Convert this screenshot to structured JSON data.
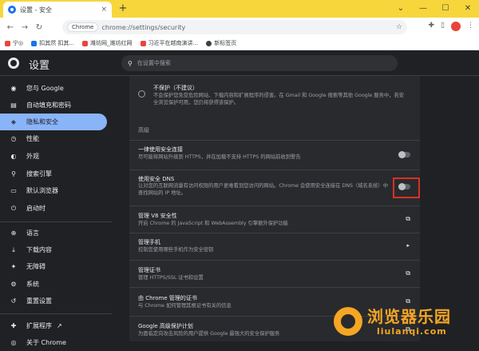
{
  "browser": {
    "tab_title": "设置 - 安全",
    "tab_close": "×",
    "new_tab": "+",
    "omnibox_chip": "Chrome",
    "url": "chrome://settings/security",
    "window_controls": [
      "⌄",
      "—",
      "☐",
      "✕"
    ]
  },
  "bookmarks": [
    {
      "label": "宁◎",
      "color": "#e8453c"
    },
    {
      "label": "扣其然 扣其...",
      "color": "#1a73e8"
    },
    {
      "label": "潍坊网_潍坊红网",
      "color": "#e8453c"
    },
    {
      "label": "习近平在越南演讲...",
      "color": "#e8453c"
    },
    {
      "label": "新标签页",
      "color": "#3c4043"
    }
  ],
  "settings": {
    "title": "设置",
    "search_placeholder": "在设置中搜索"
  },
  "sidebar": {
    "items": [
      {
        "label": "您与 Google",
        "icon": "person-icon",
        "glyph": "◉"
      },
      {
        "label": "自动填充和密码",
        "icon": "clipboard-icon",
        "glyph": "▤"
      },
      {
        "label": "隐私和安全",
        "icon": "shield-icon",
        "glyph": "◈"
      },
      {
        "label": "性能",
        "icon": "speedometer-icon",
        "glyph": "◷"
      },
      {
        "label": "外观",
        "icon": "palette-icon",
        "glyph": "◐"
      },
      {
        "label": "搜索引擎",
        "icon": "search-icon",
        "glyph": "⚲"
      },
      {
        "label": "默认浏览器",
        "icon": "browser-icon",
        "glyph": "▭"
      },
      {
        "label": "启动时",
        "icon": "power-icon",
        "glyph": "⏻"
      },
      {
        "label": "语言",
        "icon": "globe-icon",
        "glyph": "⊕"
      },
      {
        "label": "下载内容",
        "icon": "download-icon",
        "glyph": "⤓"
      },
      {
        "label": "无障碍",
        "icon": "accessibility-icon",
        "glyph": "✦"
      },
      {
        "label": "系统",
        "icon": "wrench-icon",
        "glyph": "⚙"
      },
      {
        "label": "重置设置",
        "icon": "reset-icon",
        "glyph": "↺"
      },
      {
        "label": "扩展程序",
        "icon": "puzzle-icon",
        "glyph": "✚"
      },
      {
        "label": "关于 Chrome",
        "icon": "chrome-icon",
        "glyph": "◎"
      }
    ]
  },
  "main": {
    "no_protection": {
      "title": "不保护（不建议）",
      "desc": "不会保护您免受危险网站、下载内容和扩展程序的侵害。在 Gmail 和 Google 搜索等其他 Google 服务中，若安全浏览保护可用，您仍将获得该保护。"
    },
    "advanced_label": "高级",
    "rows": [
      {
        "title": "一律使用安全连接",
        "desc": "尽可能将网站升级到 HTTPS，并在加载不支持 HTTPS 的网站前收到警告",
        "control": "toggle"
      },
      {
        "title": "使用安全 DNS",
        "desc": "让对您的互联网流量有访问权限的用户更难看到您访问的网站。Chrome 会使用安全连接在 DNS（域名系统）中查找网站的 IP 地址。",
        "control": "toggle"
      },
      {
        "title": "管理 V8 安全性",
        "desc": "开启 Chrome 的 JavaScript 和 WebAssembly 引擎额外保护功能",
        "control": "external"
      },
      {
        "title": "管理手机",
        "desc": "控制您使用哪些手机作为安全密钥",
        "control": "arrow"
      },
      {
        "title": "管理证书",
        "desc": "管理 HTTPS/SSL 证书和设置",
        "control": "external"
      },
      {
        "title": "由 Chrome 管理的证书",
        "desc": "与 Chrome 如何管理其根证书有关的信息",
        "control": "external"
      },
      {
        "title": "Google 高级保护计划",
        "desc": "为面临定向攻击风险的用户提供 Google 最强大的安全保护服务",
        "control": "external"
      }
    ]
  },
  "watermark": {
    "text": "浏览器乐园",
    "url": "liulanqi.com"
  }
}
